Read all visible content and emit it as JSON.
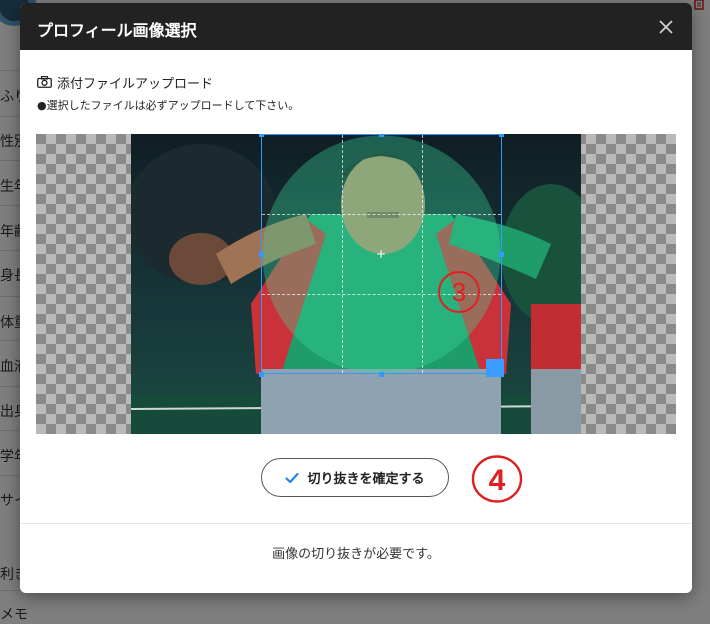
{
  "background": {
    "labels": [
      "ふり",
      "性別",
      "生年",
      "年齢",
      "身長",
      "体重",
      "血液",
      "出身",
      "学年",
      "サイ",
      "利き",
      "メモ"
    ]
  },
  "modal": {
    "title": "プロフィール画像選択",
    "close_symbol": "✕",
    "upload_link": "添付ファイルアップロード",
    "note": "●選択したファイルは必ずアップロードして下さい。",
    "crop_center_symbol": "+",
    "step3_label": "3",
    "confirm_label": "切り抜きを確定する",
    "step4_label": "4",
    "status": "画像の切り抜きが必要です。"
  },
  "colors": {
    "header_bg": "#222222",
    "accent_blue": "#3399ff",
    "annotation_red": "#e02020",
    "check_blue": "#1e88e5"
  },
  "icons": {
    "camera": "camera-icon",
    "close": "close-icon",
    "check": "check-icon",
    "trash": "trash-icon"
  }
}
